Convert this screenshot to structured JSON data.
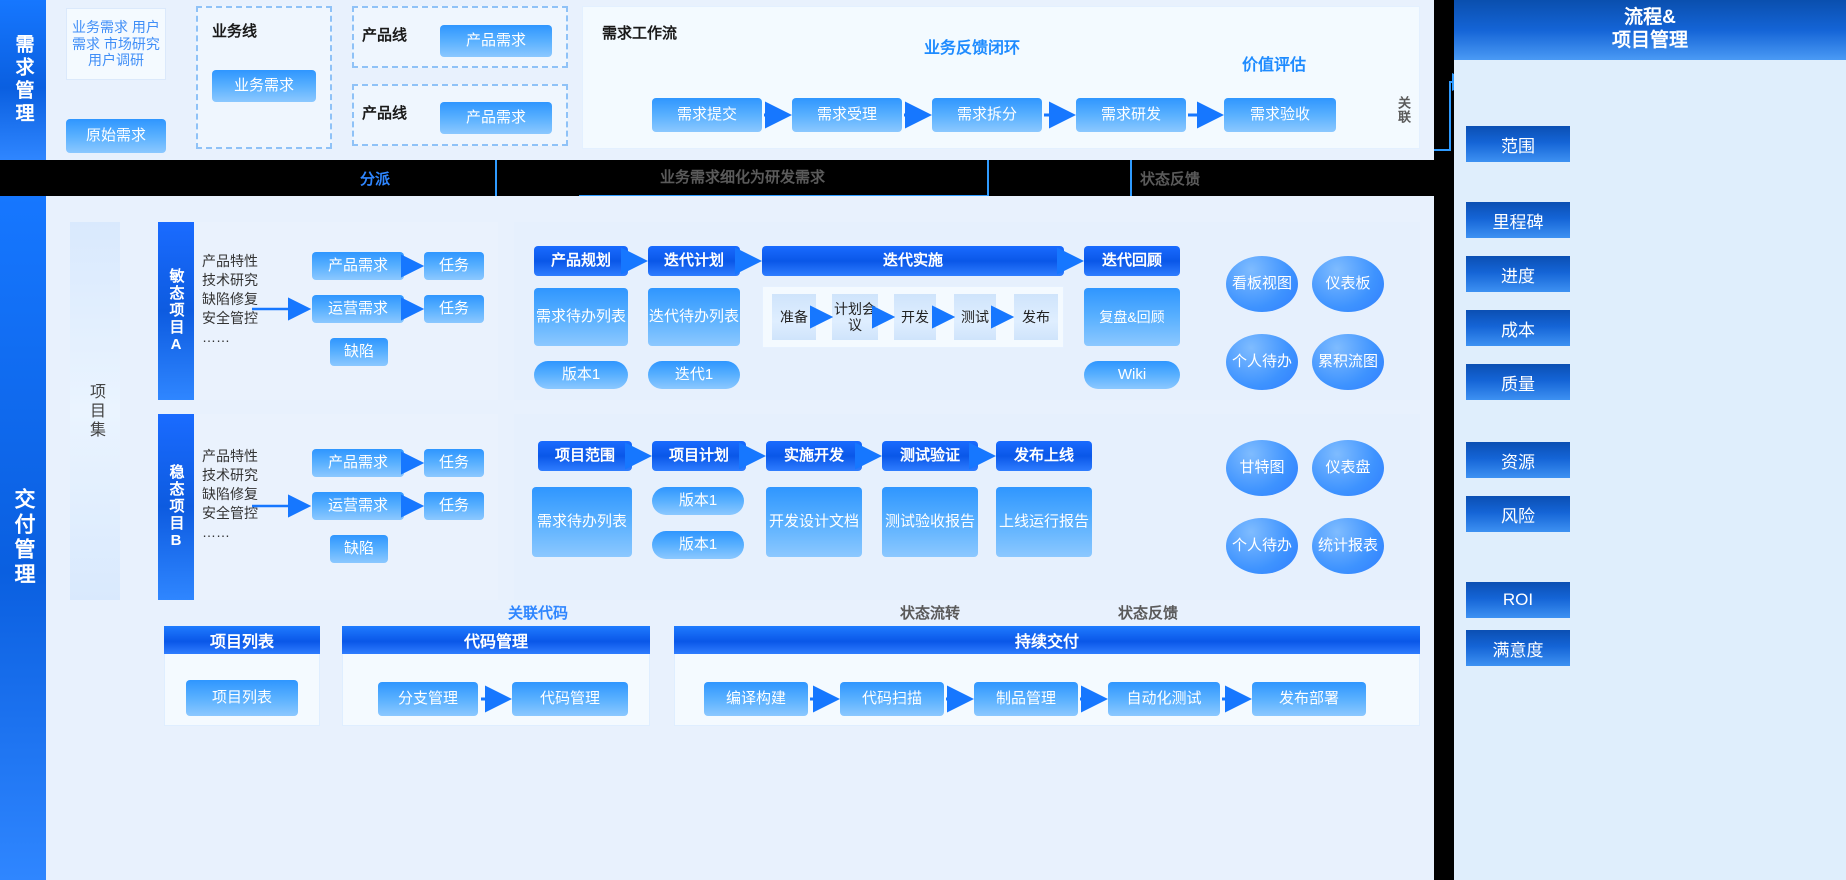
{
  "left_rail": {
    "demand": "需求管理",
    "delivery": "交付管理"
  },
  "demand_section": {
    "sources": "业务需求 用户需求 市场研究 用户调研",
    "raw_demand": "原始需求",
    "business_line_title": "业务线",
    "business_demand": "业务需求",
    "product_line_title_1": "产品线",
    "product_demand_1": "产品需求",
    "product_line_title_2": "产品线",
    "product_demand_2": "产品需求",
    "workflow_title": "需求工作流",
    "feedback_loop": "业务反馈闭环",
    "value_assessment": "价值评估",
    "steps": [
      "需求提交",
      "需求受理",
      "需求拆分",
      "需求研发",
      "需求验收"
    ]
  },
  "connector_labels": {
    "assign": "分派",
    "refine": "业务需求细化为研发需求",
    "status_feedback_top": "状态反馈",
    "link_code": "关联代码",
    "status_flow": "状态流转",
    "status_feedback_bottom": "状态反馈",
    "relate": "关联"
  },
  "programme": {
    "label": "项目集"
  },
  "project_a": {
    "tag": "敏态项目A",
    "work_types": "产品特性\n技术研究\n缺陷修复\n安全管控\n……",
    "items": [
      {
        "left": "产品需求",
        "right": "任务"
      },
      {
        "left": "运营需求",
        "right": "任务"
      }
    ],
    "defect": "缺陷",
    "phases": [
      "产品规划",
      "迭代计划",
      "迭代实施",
      "迭代回顾"
    ],
    "artifacts": [
      "需求待办列表",
      "迭代待办列表"
    ],
    "sprint_steps": [
      "准备",
      "计划会议",
      "开发",
      "测试",
      "发布"
    ],
    "retro": "复盘&回顾",
    "tags": [
      "版本1",
      "迭代1"
    ],
    "wiki": "Wiki",
    "views": [
      "看板视图",
      "仪表板",
      "个人待办",
      "累积流图"
    ]
  },
  "project_b": {
    "tag": "稳态项目B",
    "work_types": "产品特性\n技术研究\n缺陷修复\n安全管控\n……",
    "items": [
      {
        "left": "产品需求",
        "right": "任务"
      },
      {
        "left": "运营需求",
        "right": "任务"
      }
    ],
    "defect": "缺陷",
    "phases": [
      "项目范围",
      "项目计划",
      "实施开发",
      "测试验证",
      "发布上线"
    ],
    "artifacts": [
      "需求待办列表",
      "开发设计文档",
      "测试验收报告",
      "上线运行报告"
    ],
    "versions": [
      "版本1",
      "版本1"
    ],
    "views": [
      "甘特图",
      "仪表盘",
      "个人待办",
      "统计报表"
    ]
  },
  "bottom": {
    "project_list_title": "项目列表",
    "project_list_item": "项目列表",
    "code_title": "代码管理",
    "code_items": [
      "分支管理",
      "代码管理"
    ],
    "cd_title": "持续交付",
    "cd_items": [
      "编译构建",
      "代码扫描",
      "制品管理",
      "自动化测试",
      "发布部署"
    ]
  },
  "right_sidebar": {
    "title": "流程&\n项目管理",
    "title_line1": "流程&",
    "title_line2": "项目管理",
    "items": [
      "范围",
      "里程碑",
      "进度",
      "成本",
      "质量",
      "资源",
      "风险",
      "ROI",
      "满意度"
    ]
  },
  "colors": {
    "accent": "#1677ff",
    "panel": "#eaf2fd",
    "wire": "#2f9bff",
    "deep": "#0b4fb3"
  }
}
